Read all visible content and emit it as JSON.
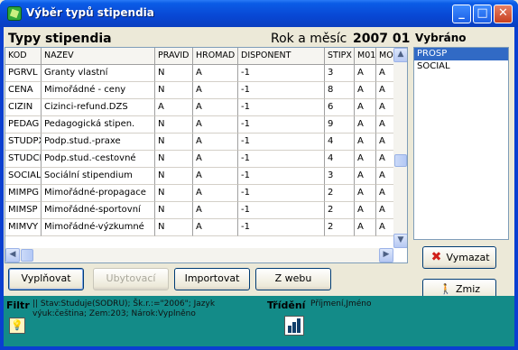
{
  "window": {
    "title": "Výběr typů stipendia"
  },
  "header": {
    "label": "Typy stipendia",
    "period_label": "Rok a měsíc",
    "period_value": "2007 01"
  },
  "grid": {
    "columns": [
      "KOD",
      "NAZEV",
      "PRAVID",
      "HROMAD",
      "DISPONENT",
      "STIPX",
      "M01",
      "MO"
    ],
    "rows": [
      [
        "PGRVL",
        "Granty vlastní",
        "N",
        "A",
        "-1",
        "3",
        "A",
        "A"
      ],
      [
        "CENA",
        "Mimořádné - ceny",
        "N",
        "A",
        "-1",
        "8",
        "A",
        "A"
      ],
      [
        "CIZIN",
        "Cizinci-refund.DZS",
        "A",
        "A",
        "-1",
        "6",
        "A",
        "A"
      ],
      [
        "PEDAG",
        "Pedagogická stipen.",
        "N",
        "A",
        "-1",
        "9",
        "A",
        "A"
      ],
      [
        "STUDPX",
        "Podp.stud.-praxe",
        "N",
        "A",
        "-1",
        "4",
        "A",
        "A"
      ],
      [
        "STUDCE",
        "Podp.stud.-cestovné",
        "N",
        "A",
        "-1",
        "4",
        "A",
        "A"
      ],
      [
        "SOCIAL",
        "Sociální stipendium",
        "N",
        "A",
        "-1",
        "3",
        "A",
        "A"
      ],
      [
        "MIMPG",
        "Mimořádné-propagace",
        "N",
        "A",
        "-1",
        "2",
        "A",
        "A"
      ],
      [
        "MIMSP",
        "Mimořádné-sportovní",
        "N",
        "A",
        "-1",
        "2",
        "A",
        "A"
      ],
      [
        "MIMVY",
        "Mimořádné-výzkumné",
        "N",
        "A",
        "-1",
        "2",
        "A",
        "A"
      ]
    ]
  },
  "selected": {
    "label": "Vybráno",
    "items": [
      "PROSP",
      "SOCIAL"
    ]
  },
  "buttons": {
    "vyplnovat": "Vyplňovat",
    "ubytovaci": "Ubytovací",
    "importovat": "Importovat",
    "zwebu": "Z webu",
    "vymazat": "Vymazat",
    "zmiz": "Zmiz"
  },
  "filter": {
    "label": "Filtr",
    "text": "|| Stav:Studuje(SODRU); Šk.r.:=\"2006\"; Jazyk výuk:čeština; Zem:203; Nárok:Vyplněno"
  },
  "sort": {
    "label": "Třídění",
    "text": "Příjmení,Jméno"
  },
  "colors": {
    "titlebar": "#0b5ce6",
    "selection": "#316ac5",
    "status_bar": "#138b88",
    "delete_icon": "#d0201a"
  }
}
